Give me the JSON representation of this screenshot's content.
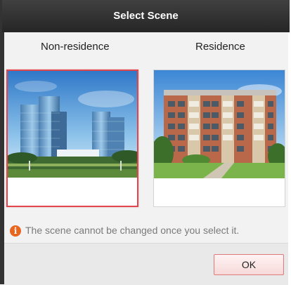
{
  "dialog": {
    "title": "Select Scene"
  },
  "scenes": [
    {
      "label": "Non-residence",
      "image": "office-towers-photo",
      "selected": true
    },
    {
      "label": "Residence",
      "image": "apartment-building-photo",
      "selected": false
    }
  ],
  "notice": {
    "icon": "info-icon",
    "text": "The scene cannot be changed once you select it."
  },
  "footer": {
    "ok_label": "OK"
  },
  "colors": {
    "title_bar": "#333333",
    "selected_border": "#e0464b",
    "info_icon": "#e8661e"
  }
}
